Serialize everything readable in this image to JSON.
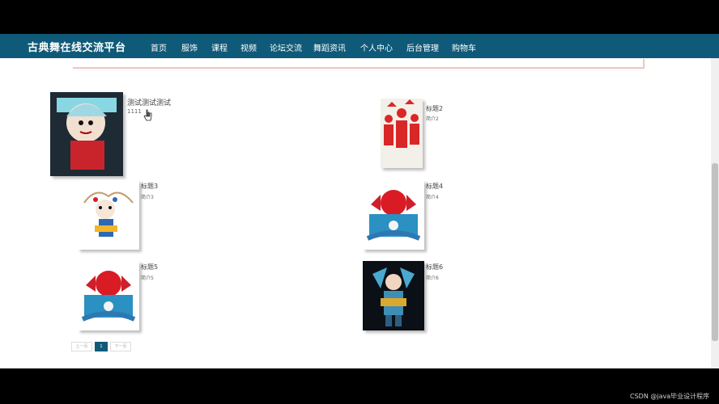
{
  "nav": {
    "brand": "古典舞在线交流平台",
    "items": [
      "首页",
      "服饰",
      "课程",
      "视频",
      "论坛交流",
      "舞蹈资讯",
      "个人中心",
      "后台管理",
      "购物车"
    ]
  },
  "cards": [
    {
      "title": "测试测试测试",
      "desc": "1111"
    },
    {
      "title": "标题2",
      "desc": "简介2"
    },
    {
      "title": "标题3",
      "desc": "简介3"
    },
    {
      "title": "标题4",
      "desc": "简介4"
    },
    {
      "title": "标题5",
      "desc": "简介5"
    },
    {
      "title": "标题6",
      "desc": "简介6"
    }
  ],
  "pagination": {
    "prev": "上一页",
    "current": "1",
    "next": "下一页"
  },
  "footer": {
    "credit": "CSDN @java毕业设计程序"
  }
}
